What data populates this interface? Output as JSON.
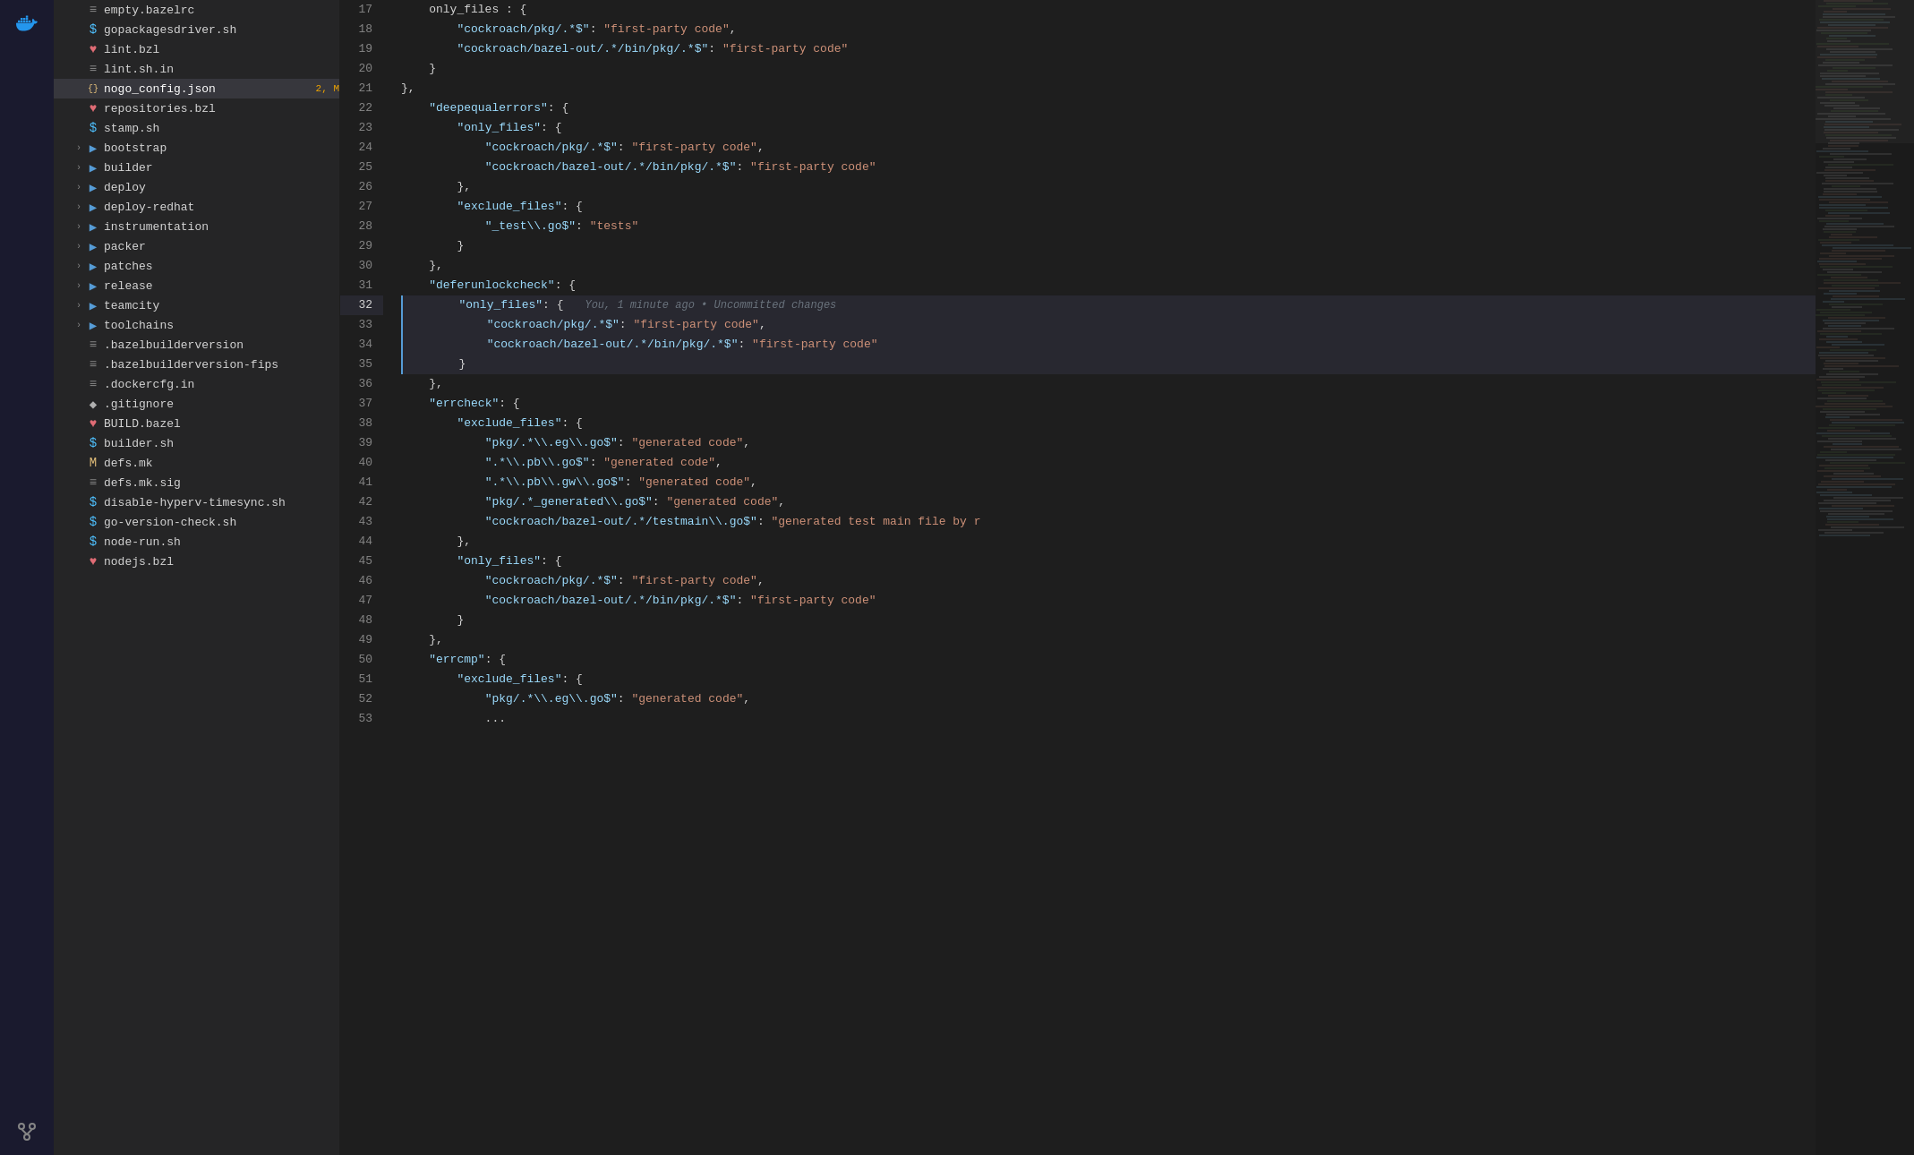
{
  "activityBar": {
    "icons": [
      {
        "name": "docker-icon",
        "symbol": "🐳",
        "active": true
      },
      {
        "name": "source-control-icon",
        "symbol": "⑂",
        "active": false
      },
      {
        "name": "extensions-icon",
        "symbol": "⬡",
        "active": false
      }
    ]
  },
  "sidebar": {
    "files": [
      {
        "id": "empty-bazelrc",
        "name": "empty.bazelrc",
        "type": "lines",
        "indent": 1,
        "chevron": false
      },
      {
        "id": "gopackagesdriver-sh",
        "name": "gopackagesdriver.sh",
        "type": "dollar",
        "indent": 1,
        "chevron": false
      },
      {
        "id": "lint-bzl",
        "name": "lint.bzl",
        "type": "heart",
        "indent": 1,
        "chevron": false
      },
      {
        "id": "lint-sh-in",
        "name": "lint.sh.in",
        "type": "lines",
        "indent": 1,
        "chevron": false
      },
      {
        "id": "nogo-config-json",
        "name": "nogo_config.json",
        "type": "json",
        "indent": 1,
        "chevron": false,
        "active": true,
        "badge": "2, M"
      },
      {
        "id": "repositories-bzl",
        "name": "repositories.bzl",
        "type": "heart",
        "indent": 1,
        "chevron": false
      },
      {
        "id": "stamp-sh",
        "name": "stamp.sh",
        "type": "dollar",
        "indent": 1,
        "chevron": false
      },
      {
        "id": "bootstrap",
        "name": "bootstrap",
        "type": "folder",
        "indent": 1,
        "chevron": true,
        "collapsed": true
      },
      {
        "id": "builder",
        "name": "builder",
        "type": "folder",
        "indent": 1,
        "chevron": true,
        "collapsed": true
      },
      {
        "id": "deploy",
        "name": "deploy",
        "type": "folder",
        "indent": 1,
        "chevron": true,
        "collapsed": true
      },
      {
        "id": "deploy-redhat",
        "name": "deploy-redhat",
        "type": "folder",
        "indent": 1,
        "chevron": true,
        "collapsed": true
      },
      {
        "id": "instrumentation",
        "name": "instrumentation",
        "type": "folder",
        "indent": 1,
        "chevron": true,
        "collapsed": true
      },
      {
        "id": "packer",
        "name": "packer",
        "type": "folder",
        "indent": 1,
        "chevron": true,
        "collapsed": true
      },
      {
        "id": "patches",
        "name": "patches",
        "type": "folder",
        "indent": 1,
        "chevron": true,
        "collapsed": true
      },
      {
        "id": "release",
        "name": "release",
        "type": "folder",
        "indent": 1,
        "chevron": true,
        "collapsed": true
      },
      {
        "id": "teamcity",
        "name": "teamcity",
        "type": "folder",
        "indent": 1,
        "chevron": true,
        "collapsed": true
      },
      {
        "id": "toolchains",
        "name": "toolchains",
        "type": "folder",
        "indent": 1,
        "chevron": true,
        "collapsed": true
      },
      {
        "id": "bazelbuilderversion",
        "name": ".bazelbuilderversion",
        "type": "lines",
        "indent": 1,
        "chevron": false
      },
      {
        "id": "bazelbuilderversion-fips",
        "name": ".bazelbuilderversion-fips",
        "type": "lines",
        "indent": 1,
        "chevron": false
      },
      {
        "id": "dockercfg-in",
        "name": ".dockercfg.in",
        "type": "lines",
        "indent": 1,
        "chevron": false
      },
      {
        "id": "gitignore",
        "name": ".gitignore",
        "type": "diamond",
        "indent": 1,
        "chevron": false
      },
      {
        "id": "build-bazel",
        "name": "BUILD.bazel",
        "type": "heart",
        "indent": 1,
        "chevron": false
      },
      {
        "id": "builder-sh",
        "name": "builder.sh",
        "type": "dollar",
        "indent": 1,
        "chevron": false
      },
      {
        "id": "defs-mk",
        "name": "defs.mk",
        "type": "m-icon",
        "indent": 1,
        "chevron": false
      },
      {
        "id": "defs-mk-sig",
        "name": "defs.mk.sig",
        "type": "lines",
        "indent": 1,
        "chevron": false
      },
      {
        "id": "disable-hyperv-timesync-sh",
        "name": "disable-hyperv-timesync.sh",
        "type": "dollar",
        "indent": 1,
        "chevron": false
      },
      {
        "id": "go-version-check-sh",
        "name": "go-version-check.sh",
        "type": "dollar",
        "indent": 1,
        "chevron": false
      },
      {
        "id": "node-run-sh",
        "name": "node-run.sh",
        "type": "dollar",
        "indent": 1,
        "chevron": false
      },
      {
        "id": "nodejs-bzl",
        "name": "nodejs.bzl",
        "type": "heart",
        "indent": 1,
        "chevron": false
      }
    ]
  },
  "editor": {
    "filename": "nogo_config.json",
    "lines": [
      {
        "num": 17,
        "content": [
          {
            "t": "punct",
            "v": "    only_files : {"
          }
        ]
      },
      {
        "num": 18,
        "content": [
          {
            "t": "punct",
            "v": "        "
          },
          {
            "t": "key",
            "v": "\"cockroach/pkg/.*$\""
          },
          {
            "t": "punct",
            "v": ": "
          },
          {
            "t": "string",
            "v": "\"first-party code\""
          },
          {
            "t": "punct",
            "v": ","
          }
        ]
      },
      {
        "num": 19,
        "content": [
          {
            "t": "punct",
            "v": "        "
          },
          {
            "t": "key",
            "v": "\"cockroach/bazel-out/.*/bin/pkg/.*$\""
          },
          {
            "t": "punct",
            "v": ": "
          },
          {
            "t": "string",
            "v": "\"first-party code\""
          }
        ]
      },
      {
        "num": 20,
        "content": [
          {
            "t": "punct",
            "v": "    }"
          }
        ]
      },
      {
        "num": 21,
        "content": [
          {
            "t": "punct",
            "v": "},"
          }
        ]
      },
      {
        "num": 22,
        "content": [
          {
            "t": "punct",
            "v": "    "
          },
          {
            "t": "key",
            "v": "\"deepequalerrors\""
          },
          {
            "t": "punct",
            "v": ": {"
          }
        ]
      },
      {
        "num": 23,
        "content": [
          {
            "t": "punct",
            "v": "        "
          },
          {
            "t": "key",
            "v": "\"only_files\""
          },
          {
            "t": "punct",
            "v": ": {"
          }
        ]
      },
      {
        "num": 24,
        "content": [
          {
            "t": "punct",
            "v": "            "
          },
          {
            "t": "key",
            "v": "\"cockroach/pkg/.*$\""
          },
          {
            "t": "punct",
            "v": ": "
          },
          {
            "t": "string",
            "v": "\"first-party code\""
          },
          {
            "t": "punct",
            "v": ","
          }
        ]
      },
      {
        "num": 25,
        "content": [
          {
            "t": "punct",
            "v": "            "
          },
          {
            "t": "key",
            "v": "\"cockroach/bazel-out/.*/bin/pkg/.*$\""
          },
          {
            "t": "punct",
            "v": ": "
          },
          {
            "t": "string",
            "v": "\"first-party code\""
          }
        ]
      },
      {
        "num": 26,
        "content": [
          {
            "t": "punct",
            "v": "        },"
          }
        ]
      },
      {
        "num": 27,
        "content": [
          {
            "t": "punct",
            "v": "        "
          },
          {
            "t": "key",
            "v": "\"exclude_files\""
          },
          {
            "t": "punct",
            "v": ": {"
          }
        ]
      },
      {
        "num": 28,
        "content": [
          {
            "t": "punct",
            "v": "            "
          },
          {
            "t": "key",
            "v": "\"_test\\\\.go$\""
          },
          {
            "t": "punct",
            "v": ": "
          },
          {
            "t": "string",
            "v": "\"tests\""
          }
        ]
      },
      {
        "num": 29,
        "content": [
          {
            "t": "punct",
            "v": "        }"
          }
        ]
      },
      {
        "num": 30,
        "content": [
          {
            "t": "punct",
            "v": "    },"
          }
        ]
      },
      {
        "num": 31,
        "content": [
          {
            "t": "punct",
            "v": "    "
          },
          {
            "t": "key",
            "v": "\"deferunlockcheck\""
          },
          {
            "t": "punct",
            "v": ": {"
          }
        ]
      },
      {
        "num": 32,
        "content": [
          {
            "t": "punct",
            "v": "        "
          },
          {
            "t": "key",
            "v": "\"only_files\""
          },
          {
            "t": "punct",
            "v": ": {"
          }
        ],
        "active": true,
        "blame": "You, 1 minute ago • Uncommitted changes"
      },
      {
        "num": 33,
        "content": [
          {
            "t": "punct",
            "v": "            "
          },
          {
            "t": "key",
            "v": "\"cockroach/pkg/.*$\""
          },
          {
            "t": "punct",
            "v": ": "
          },
          {
            "t": "string",
            "v": "\"first-party code\""
          },
          {
            "t": "punct",
            "v": ","
          }
        ]
      },
      {
        "num": 34,
        "content": [
          {
            "t": "punct",
            "v": "            "
          },
          {
            "t": "key",
            "v": "\"cockroach/bazel-out/.*/bin/pkg/.*$\""
          },
          {
            "t": "punct",
            "v": ": "
          },
          {
            "t": "string",
            "v": "\"first-party code\""
          }
        ]
      },
      {
        "num": 35,
        "content": [
          {
            "t": "punct",
            "v": "        }"
          }
        ]
      },
      {
        "num": 36,
        "content": [
          {
            "t": "punct",
            "v": "    },"
          }
        ]
      },
      {
        "num": 37,
        "content": [
          {
            "t": "punct",
            "v": "    "
          },
          {
            "t": "key",
            "v": "\"errcheck\""
          },
          {
            "t": "punct",
            "v": ": {"
          }
        ]
      },
      {
        "num": 38,
        "content": [
          {
            "t": "punct",
            "v": "        "
          },
          {
            "t": "key",
            "v": "\"exclude_files\""
          },
          {
            "t": "punct",
            "v": ": {"
          }
        ]
      },
      {
        "num": 39,
        "content": [
          {
            "t": "punct",
            "v": "            "
          },
          {
            "t": "key",
            "v": "\"pkg/.*\\\\.eg\\\\.go$\""
          },
          {
            "t": "punct",
            "v": ": "
          },
          {
            "t": "string",
            "v": "\"generated code\""
          },
          {
            "t": "punct",
            "v": ","
          }
        ]
      },
      {
        "num": 40,
        "content": [
          {
            "t": "punct",
            "v": "            "
          },
          {
            "t": "key",
            "v": "\".*\\\\.pb\\\\.go$\""
          },
          {
            "t": "punct",
            "v": ": "
          },
          {
            "t": "string",
            "v": "\"generated code\""
          },
          {
            "t": "punct",
            "v": ","
          }
        ]
      },
      {
        "num": 41,
        "content": [
          {
            "t": "punct",
            "v": "            "
          },
          {
            "t": "key",
            "v": "\".*\\\\.pb\\\\.gw\\\\.go$\""
          },
          {
            "t": "punct",
            "v": ": "
          },
          {
            "t": "string",
            "v": "\"generated code\""
          },
          {
            "t": "punct",
            "v": ","
          }
        ]
      },
      {
        "num": 42,
        "content": [
          {
            "t": "punct",
            "v": "            "
          },
          {
            "t": "key",
            "v": "\"pkg/.*_generated\\\\.go$\""
          },
          {
            "t": "punct",
            "v": ": "
          },
          {
            "t": "string",
            "v": "\"generated code\""
          },
          {
            "t": "punct",
            "v": ","
          }
        ]
      },
      {
        "num": 43,
        "content": [
          {
            "t": "punct",
            "v": "            "
          },
          {
            "t": "key",
            "v": "\"cockroach/bazel-out/.*/testmain\\\\.go$\""
          },
          {
            "t": "punct",
            "v": ": "
          },
          {
            "t": "string",
            "v": "\"generated test main file by r"
          }
        ]
      },
      {
        "num": 44,
        "content": [
          {
            "t": "punct",
            "v": "        },"
          }
        ]
      },
      {
        "num": 45,
        "content": [
          {
            "t": "punct",
            "v": "        "
          },
          {
            "t": "key",
            "v": "\"only_files\""
          },
          {
            "t": "punct",
            "v": ": {"
          }
        ]
      },
      {
        "num": 46,
        "content": [
          {
            "t": "punct",
            "v": "            "
          },
          {
            "t": "key",
            "v": "\"cockroach/pkg/.*$\""
          },
          {
            "t": "punct",
            "v": ": "
          },
          {
            "t": "string",
            "v": "\"first-party code\""
          },
          {
            "t": "punct",
            "v": ","
          }
        ]
      },
      {
        "num": 47,
        "content": [
          {
            "t": "punct",
            "v": "            "
          },
          {
            "t": "key",
            "v": "\"cockroach/bazel-out/.*/bin/pkg/.*$\""
          },
          {
            "t": "punct",
            "v": ": "
          },
          {
            "t": "string",
            "v": "\"first-party code\""
          }
        ]
      },
      {
        "num": 48,
        "content": [
          {
            "t": "punct",
            "v": "        }"
          }
        ]
      },
      {
        "num": 49,
        "content": [
          {
            "t": "punct",
            "v": "    },"
          }
        ]
      },
      {
        "num": 50,
        "content": [
          {
            "t": "punct",
            "v": "    "
          },
          {
            "t": "key",
            "v": "\"errcmp\""
          },
          {
            "t": "punct",
            "v": ": {"
          }
        ]
      },
      {
        "num": 51,
        "content": [
          {
            "t": "punct",
            "v": "        "
          },
          {
            "t": "key",
            "v": "\"exclude_files\""
          },
          {
            "t": "punct",
            "v": ": {"
          }
        ]
      },
      {
        "num": 52,
        "content": [
          {
            "t": "punct",
            "v": "            "
          },
          {
            "t": "key",
            "v": "\"pkg/.*\\\\.eg\\\\.go$\""
          },
          {
            "t": "punct",
            "v": ": "
          },
          {
            "t": "string",
            "v": "\"generated code\""
          },
          {
            "t": "punct",
            "v": ","
          }
        ]
      },
      {
        "num": 53,
        "content": [
          {
            "t": "punct",
            "v": "            ..."
          }
        ]
      }
    ]
  },
  "minimap": {
    "label": "minimap"
  }
}
